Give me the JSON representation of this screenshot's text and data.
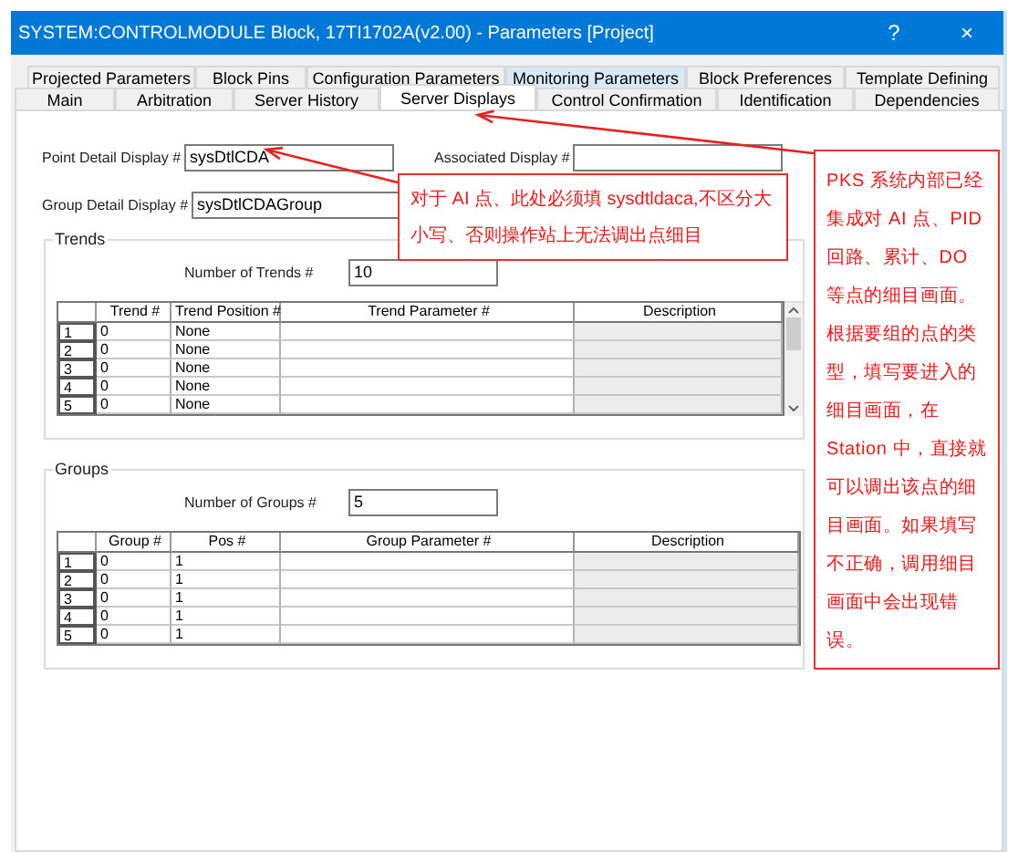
{
  "window": {
    "title": "SYSTEM:CONTROLMODULE Block, 17TI1702A(v2.00) - Parameters [Project]",
    "help": "?",
    "close": "×"
  },
  "tab_rows": [
    {
      "tabs": [
        {
          "label": "Projected Parameters",
          "selected": false,
          "highlighted": false
        },
        {
          "label": "Block Pins",
          "selected": false,
          "highlighted": false
        },
        {
          "label": "Configuration Parameters",
          "selected": false,
          "highlighted": false
        },
        {
          "label": "Monitoring Parameters",
          "selected": false,
          "highlighted": true
        },
        {
          "label": "Block Preferences",
          "selected": false,
          "highlighted": false
        },
        {
          "label": "Template Defining",
          "selected": false,
          "highlighted": false
        }
      ]
    },
    {
      "tabs": [
        {
          "label": "Main",
          "selected": false,
          "highlighted": false
        },
        {
          "label": "Arbitration",
          "selected": false,
          "highlighted": false
        },
        {
          "label": "Server History",
          "selected": false,
          "highlighted": false
        },
        {
          "label": "Server Displays",
          "selected": true,
          "highlighted": false
        },
        {
          "label": "Control Confirmation",
          "selected": false,
          "highlighted": false
        },
        {
          "label": "Identification",
          "selected": false,
          "highlighted": false
        },
        {
          "label": "Dependencies",
          "selected": false,
          "highlighted": false
        }
      ]
    }
  ],
  "fields": [
    {
      "label": "Point Detail Display #",
      "value": "sysDtlCDA"
    },
    {
      "label": "Associated Display #"
    },
    {
      "label": "Group Detail Display #",
      "value": "sysDtlCDAGroup"
    }
  ],
  "sections": [
    {
      "title": "Trends",
      "count_label": "Number of Trends #",
      "count_value": "10",
      "table": {
        "scrollable": true,
        "columns": [
          "Trend #",
          "Trend Position #",
          "Trend Parameter #",
          "Description"
        ],
        "rows": [
          {
            "index": "1",
            "cells": [
              "0",
              "None"
            ]
          },
          {
            "index": "2",
            "cells": [
              "0",
              "None"
            ]
          },
          {
            "index": "3",
            "cells": [
              "0",
              "None"
            ]
          },
          {
            "index": "4",
            "cells": [
              "0",
              "None"
            ]
          },
          {
            "index": "5",
            "cells": [
              "0",
              "None"
            ]
          }
        ]
      }
    },
    {
      "title": "Groups",
      "count_label": "Number of Groups #",
      "count_value": "5",
      "table": {
        "scrollable": false,
        "columns": [
          "Group #",
          "Pos #",
          "Group Parameter #",
          "Description"
        ],
        "rows": [
          {
            "index": "1",
            "cells": [
              "0",
              "1"
            ]
          },
          {
            "index": "2",
            "cells": [
              "0",
              "1"
            ]
          },
          {
            "index": "3",
            "cells": [
              "0",
              "1"
            ]
          },
          {
            "index": "4",
            "cells": [
              "0",
              "1"
            ]
          },
          {
            "index": "5",
            "cells": [
              "0",
              "1"
            ]
          }
        ]
      }
    }
  ],
  "annotations": [
    {
      "kind": "field-note",
      "text": "对于 AI 点、此处必须填 sysdtldaca,不区分大小写、否则操作站上无法调出点细目"
    },
    {
      "kind": "side-note",
      "text": "PKS 系统内部已经集成对 AI 点、PID 回路、累计、DO 等点的细目画面。根据要组的点的类型，填写要进入的细目画面，在 Station 中，直接就可以调出该点的细目画面。如果填写不正确，调用细目画面中会出现错误。"
    }
  ]
}
